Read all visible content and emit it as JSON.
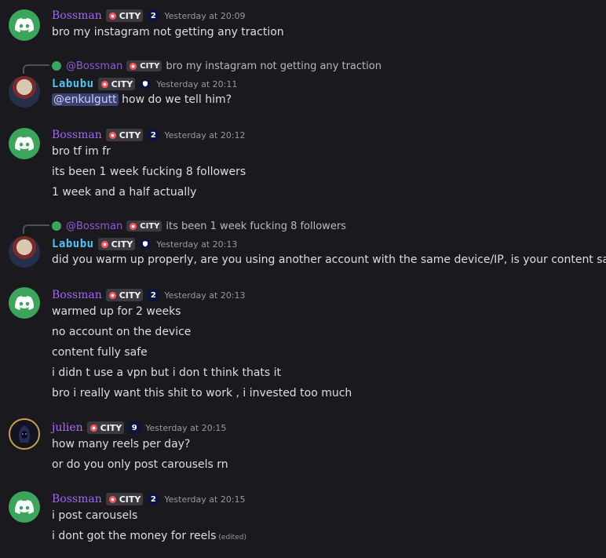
{
  "tag_label": "CITY",
  "colors": {
    "background": "#1a1a1e",
    "bossman": "#a266f2",
    "labubu": "#4fc4f2",
    "julien": "#b86af7",
    "discord_green": "#3ba55c",
    "mention_bg": "#3c4270"
  },
  "messages": [
    {
      "author": "Bossman",
      "level": "2",
      "time": "Yesterday at 20:09",
      "lines": [
        "bro my instagram not getting any traction"
      ]
    },
    {
      "reply": {
        "author": "@Bossman",
        "text": "bro my instagram not getting any traction"
      },
      "author": "Labubu",
      "time": "Yesterday at 20:11",
      "mention": "@enkulgutt",
      "lines": [
        "how do we tell him?"
      ]
    },
    {
      "author": "Bossman",
      "level": "2",
      "time": "Yesterday at 20:12",
      "lines": [
        "bro tf im fr",
        "its been 1 week fucking 8 followers",
        "1 week and a half actually"
      ]
    },
    {
      "reply": {
        "author": "@Bossman",
        "text": "its been 1 week fucking 8 followers"
      },
      "author": "Labubu",
      "time": "Yesterday at 20:13",
      "lines": [
        "did you warm up properly, are you using another account with the same device/IP, is your content safe?"
      ]
    },
    {
      "author": "Bossman",
      "level": "2",
      "time": "Yesterday at 20:13",
      "lines": [
        "warmed up for 2 weeks",
        "no account on the device",
        "content fully safe",
        "i didn t use a  vpn but i don t think thats it",
        "bro i really want this shit to work , i invested too much"
      ]
    },
    {
      "author": "julien",
      "level": "9",
      "time": "Yesterday at 20:15",
      "lines": [
        "how many reels per day?",
        "or do you only post carousels rn"
      ]
    },
    {
      "author": "Bossman",
      "level": "2",
      "time": "Yesterday at 20:15",
      "lines": [
        "i post carousels",
        "i dont got the money for reels"
      ],
      "edited": "(edited)"
    }
  ]
}
